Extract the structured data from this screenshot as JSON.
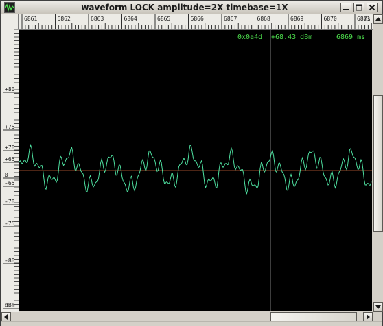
{
  "window": {
    "title": "waveform  LOCK amplitude=2X timebase=1X"
  },
  "ruler_top": {
    "labels": [
      "6861",
      "6862",
      "6863",
      "6864",
      "6865",
      "6866",
      "6867",
      "6868",
      "6869",
      "6870",
      "6871",
      "ms"
    ]
  },
  "ruler_left": {
    "labels": [
      "+80",
      "+75",
      "+70",
      "+65",
      "0",
      "-65",
      "-70",
      "-75",
      "-80",
      "dBm"
    ]
  },
  "readout": {
    "code": "0x0a4d",
    "level": "+68.43 dBm",
    "time": "6869 ms"
  },
  "colors": {
    "trace": "#4ee0a0",
    "baseline": "#9a4a2a",
    "cursor": "#7a7a7a",
    "readout": "#4ee04e",
    "plot_background": "#000000"
  },
  "icons": {
    "app": "waveform-app-icon",
    "minimize": "minimize-icon",
    "maximize": "maximize-icon",
    "close": "close-icon",
    "scroll_up": "arrow-up-icon",
    "scroll_down": "arrow-down-icon",
    "scroll_left": "arrow-left-icon",
    "scroll_right": "arrow-right-icon"
  }
}
